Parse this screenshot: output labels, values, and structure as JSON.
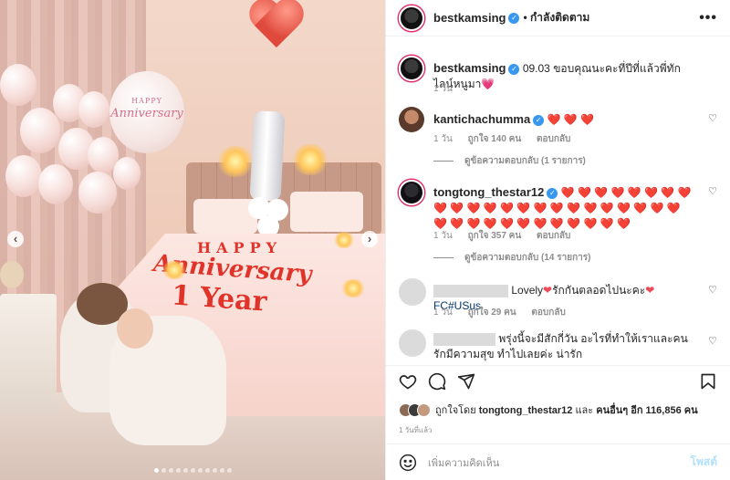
{
  "colors": {
    "accent": "#3897f0",
    "heart_red": "#ed4956",
    "muted": "#8e8e8e"
  },
  "photo": {
    "balloon_text_small": "HAPPY",
    "balloon_text": "Anniversary",
    "bed_line1": "HAPPY",
    "bed_line2": "Anniversary",
    "bed_line3": "1 Year",
    "carousel_dots": 11,
    "active_dot": 0,
    "icons": {
      "prev": "chevron-left-icon",
      "next": "chevron-right-icon"
    }
  },
  "header": {
    "username": "bestkamsing",
    "follow_label": "• กำลังติดตาม",
    "more": "•••"
  },
  "caption": {
    "username": "bestkamsing",
    "text": "09.03 ขอบคุณนะคะที่ปีที่แล้วพี่ทักไลน์หนูมา💗",
    "time": "1 วัน"
  },
  "comments": [
    {
      "username": "kantichachumma",
      "text": "❤️ ❤️ ❤️",
      "time": "1 วัน",
      "likes": "ถูกใจ 140 คน",
      "reply": "ตอบกลับ",
      "view_replies": "ดูข้อความตอบกลับ (1 รายการ)"
    },
    {
      "username": "tongtong_thestar12",
      "text": "❤️ ❤️ ❤️ ❤️ ❤️ ❤️ ❤️ ❤️ ❤️ ❤️ ❤️ ❤️ ❤️ ❤️ ❤️ ❤️ ❤️ ❤️ ❤️ ❤️ ❤️ ❤️ ❤️ ❤️ ❤️ ❤️ ❤️ ❤️ ❤️ ❤️ ❤️ ❤️ ❤️ ❤️ ❤️",
      "time": "1 วัน",
      "likes": "ถูกใจ 357 คน",
      "reply": "ตอบกลับ",
      "view_replies": "ดูข้อความตอบกลับ (14 รายการ)"
    },
    {
      "username": "",
      "text_a": "Lovely",
      "text_b": "รักกันตลอดไปนะคะ",
      "tag": "FC#USus",
      "time": "1 วัน",
      "likes": "ถูกใจ 29 คน",
      "reply": "ตอบกลับ"
    },
    {
      "username": "",
      "text": "พรุ่งนี้จะมีสักกี่วัน อะไรที่ทำให้เราและคนรักมีความสุข ทำไปเลยค่ะ น่ารัก"
    }
  ],
  "likes": {
    "prefix": "ถูกใจโดย",
    "user": "tongtong_thestar12",
    "middle": "และ",
    "others": "คนอื่นๆ อีก 116,856 คน"
  },
  "post_time": "1 วันที่แล้ว",
  "add_comment": {
    "placeholder": "เพิ่มความคิดเห็น",
    "post_label": "โพสต์"
  }
}
